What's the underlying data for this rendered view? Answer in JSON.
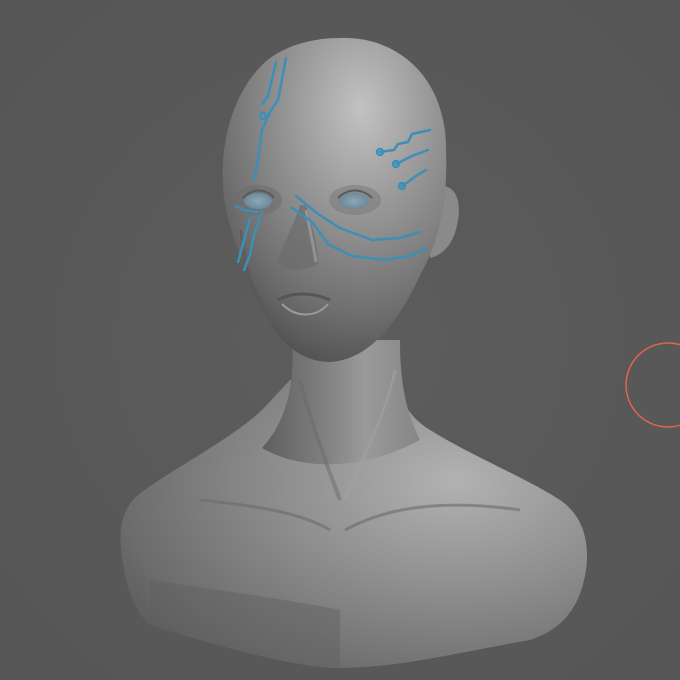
{
  "viewport": {
    "background_color": "#5a5a5a",
    "model_color": "#8c8c8c",
    "model_highlight_color": "#bdbdbd",
    "model_shadow_color": "#4a4a4a",
    "polypaint_stroke_color": "#3d8fb8",
    "brush_cursor_color": "#e0654a"
  },
  "model": {
    "subject": "sculpted-female-bust"
  },
  "brush_cursor": {
    "shape": "circle",
    "icon": "brush-cursor-icon"
  }
}
